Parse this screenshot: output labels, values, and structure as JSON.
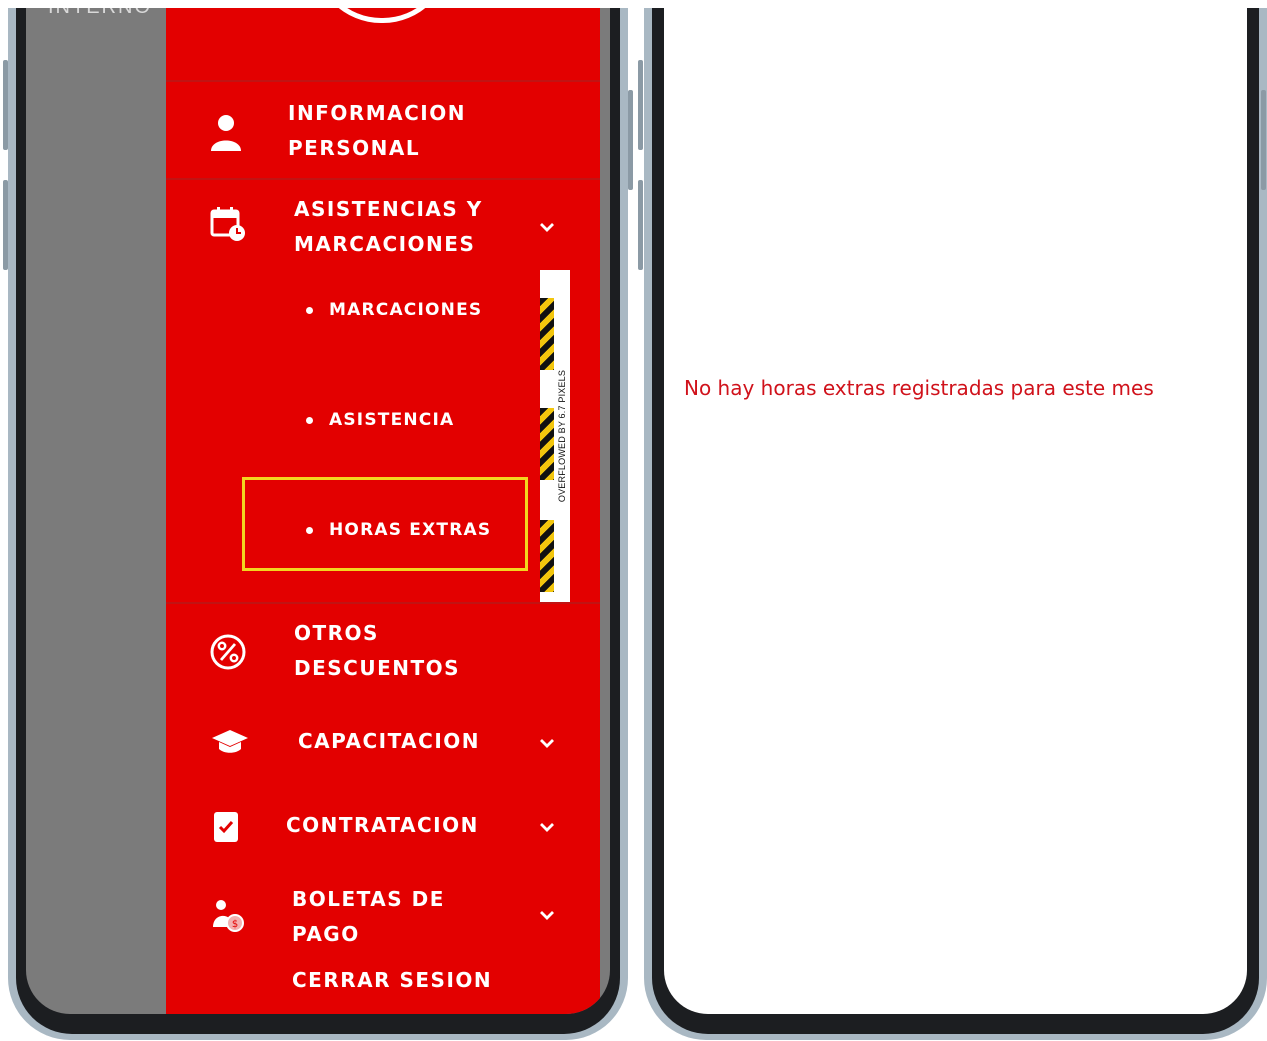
{
  "background_label": "INTERNO",
  "menu": {
    "items": [
      {
        "label_line1": "INFORMACION",
        "label_line2": "PERSONAL",
        "icon": "person-icon",
        "has_chevron": false
      },
      {
        "label_line1": "ASISTENCIAS Y",
        "label_line2": "MARCACIONES",
        "icon": "calendar-clock-icon",
        "has_chevron": true
      },
      {
        "label_line1": "OTROS",
        "label_line2": "DESCUENTOS",
        "icon": "percent-icon",
        "has_chevron": false
      },
      {
        "label_line1": "CAPACITACION",
        "label_line2": "",
        "icon": "graduation-cap-icon",
        "has_chevron": true
      },
      {
        "label_line1": "CONTRATACION",
        "label_line2": "",
        "icon": "clipboard-check-icon",
        "has_chevron": true
      },
      {
        "label_line1": "BOLETAS DE",
        "label_line2": "PAGO",
        "icon": "person-money-icon",
        "has_chevron": true
      }
    ],
    "subitems": [
      "MARCACIONES",
      "ASISTENCIA",
      "HORAS EXTRAS"
    ],
    "selected_subitem": "HORAS EXTRAS",
    "logout_label": "CERRAR SESION"
  },
  "overflow_warning": "OVERFLOWED BY 6.7 PIXELS",
  "overflow_warning_tail": "OWED BY 6.7 PIXELS",
  "overflow_warning_head": "VERFL",
  "right_screen": {
    "empty_message": "No hay horas extras registradas para este mes"
  },
  "colors": {
    "drawer": "#e30000",
    "highlight_border": "#f3d51f",
    "message_text": "#d0121b"
  }
}
